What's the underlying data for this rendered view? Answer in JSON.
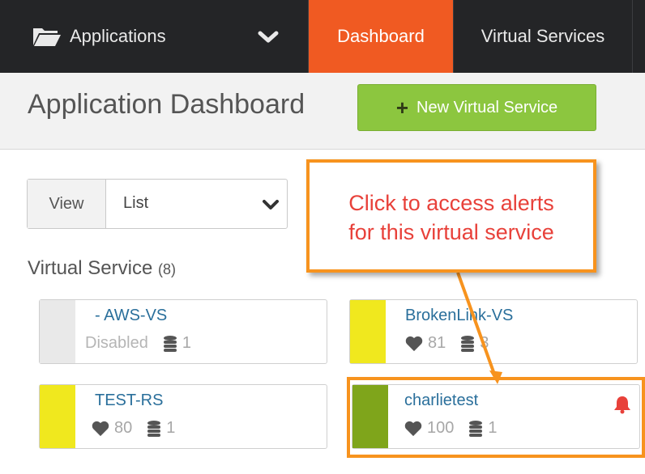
{
  "nav": {
    "applications_label": "Applications",
    "dashboard_tab": "Dashboard",
    "virtual_services_tab": "Virtual Services"
  },
  "header": {
    "title": "Application Dashboard",
    "new_button_plus": "+",
    "new_button_label": "New Virtual Service"
  },
  "view": {
    "label": "View",
    "selected": "List"
  },
  "section": {
    "title": "Virtual Service",
    "count": "(8)"
  },
  "cards": [
    {
      "name": "- AWS-VS",
      "status_text": "Disabled",
      "pools": "1",
      "health": "",
      "bar_color": "#e9e9e9"
    },
    {
      "name": "BrokenLink-VS",
      "health": "81",
      "pools": "3",
      "bar_color": "#f0e81e"
    },
    {
      "name": "TEST-RS",
      "health": "80",
      "pools": "1",
      "bar_color": "#f0e81e"
    },
    {
      "name": "charlietest",
      "health": "100",
      "pools": "1",
      "bar_color": "#7fa51b",
      "alert": true
    }
  ],
  "callout": {
    "line1": "Click to access alerts",
    "line2": "for this virtual service"
  },
  "colors": {
    "nav_bg": "#242527",
    "accent": "#f05a22",
    "button_green": "#8cc63f",
    "callout_border": "#f7931e",
    "callout_text": "#e8413a"
  },
  "icons": [
    "folder-icon",
    "chevron-down-icon",
    "plus-icon",
    "heart-icon",
    "database-icon",
    "bell-icon"
  ]
}
